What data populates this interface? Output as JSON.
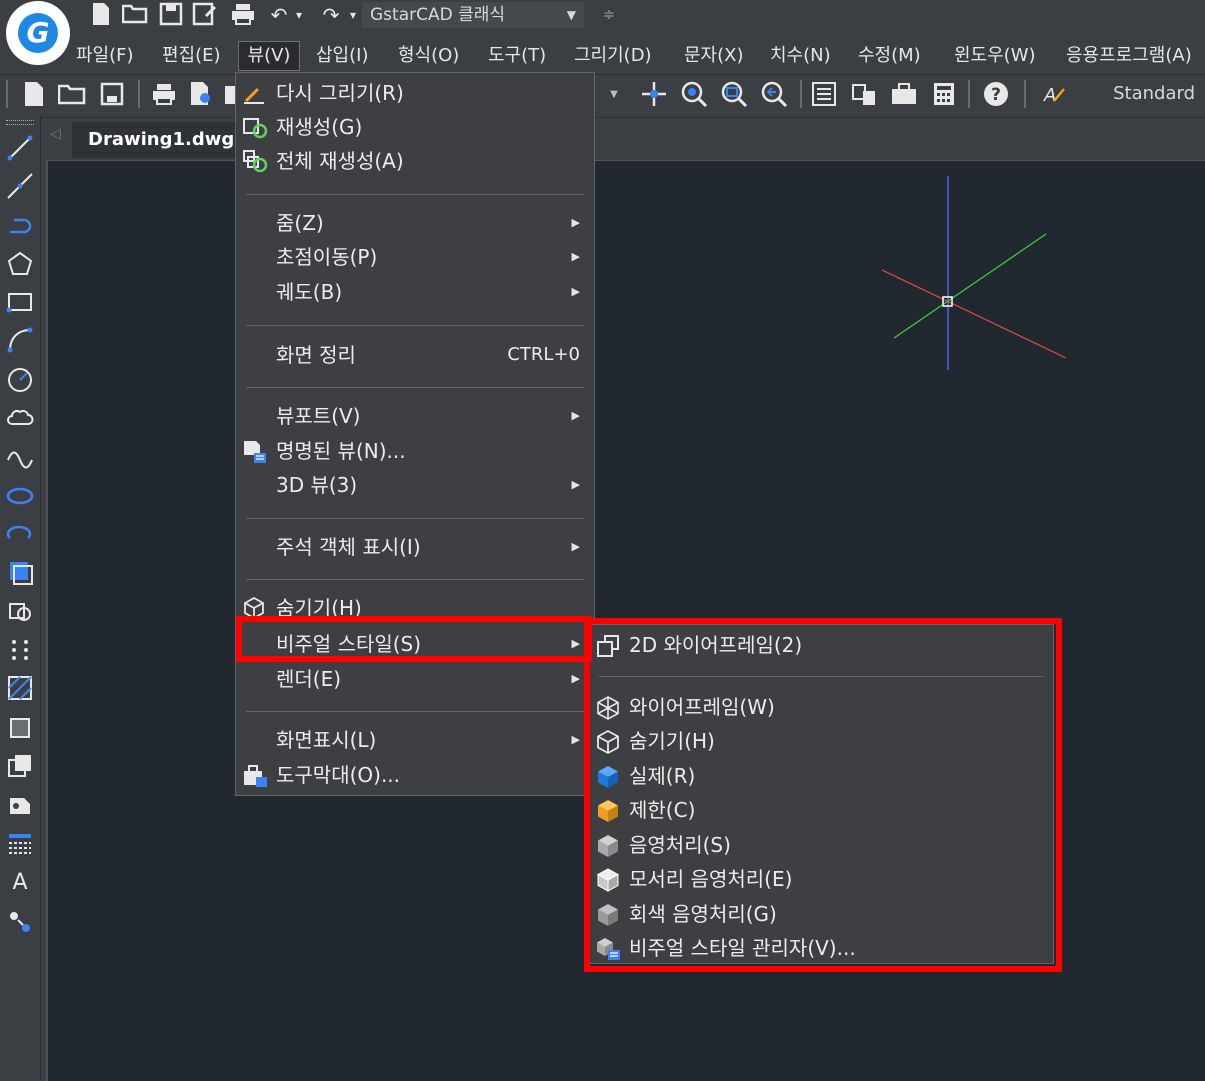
{
  "app": {
    "workspace": "GstarCAD 클래식",
    "text_style": "Standard"
  },
  "colors": {
    "highlight": "#ff0000",
    "canvas": "#212830",
    "menu_bg": "#3e3f42",
    "logo_blue": "#1e88e5"
  },
  "menubar": {
    "items": [
      "파일(F)",
      "편집(E)",
      "뷰(V)",
      "삽입(I)",
      "형식(O)",
      "도구(T)",
      "그리기(D)",
      "문자(X)",
      "치수(N)",
      "수정(M)",
      "윈도우(W)",
      "응용프로그램(A)"
    ],
    "active": "뷰(V)"
  },
  "tabs": {
    "active": "Drawing1.dwg"
  },
  "view_menu": {
    "items": [
      {
        "label": "다시 그리기(R)",
        "icon": "redraw-icon"
      },
      {
        "label": "재생성(G)",
        "icon": "regen-icon"
      },
      {
        "label": "전체 재생성(A)",
        "icon": "regen-all-icon"
      },
      {
        "label": "줌(Z)",
        "submenu": true
      },
      {
        "label": "초점이동(P)",
        "submenu": true
      },
      {
        "label": "궤도(B)",
        "submenu": true
      },
      {
        "label": "화면 정리",
        "shortcut": "CTRL+0"
      },
      {
        "label": "뷰포트(V)",
        "submenu": true
      },
      {
        "label": "명명된 뷰(N)...",
        "icon": "named-views-icon"
      },
      {
        "label": "3D 뷰(3)",
        "submenu": true
      },
      {
        "label": "주석 객체 표시(I)",
        "submenu": true
      },
      {
        "label": "숨기기(H)",
        "icon": "hide-icon"
      },
      {
        "label": "비주얼 스타일(S)",
        "submenu": true,
        "selected": true
      },
      {
        "label": "렌더(E)",
        "submenu": true
      },
      {
        "label": "화면표시(L)",
        "submenu": true
      },
      {
        "label": "도구막대(O)...",
        "icon": "toolbar-icon"
      }
    ]
  },
  "visual_styles_submenu": {
    "items": [
      {
        "label": "2D 와이어프레임(2)",
        "icon": "wireframe-2d-icon"
      },
      {
        "label": "와이어프레임(W)",
        "icon": "wireframe-3d-icon"
      },
      {
        "label": "숨기기(H)",
        "icon": "hidden-icon"
      },
      {
        "label": "실제(R)",
        "icon": "realistic-icon",
        "color": "#1f7ae0"
      },
      {
        "label": "제한(C)",
        "icon": "conceptual-icon",
        "color": "#f0a020"
      },
      {
        "label": "음영처리(S)",
        "icon": "shaded-icon",
        "color": "#a9a9a9"
      },
      {
        "label": "모서리 음영처리(E)",
        "icon": "shaded-edges-icon",
        "color": "#c8c8c8"
      },
      {
        "label": "회색 음영처리(G)",
        "icon": "shades-of-gray-icon",
        "color": "#9a9a9a"
      },
      {
        "label": "비주얼 스타일 관리자(V)...",
        "icon": "visual-styles-manager-icon"
      }
    ]
  }
}
